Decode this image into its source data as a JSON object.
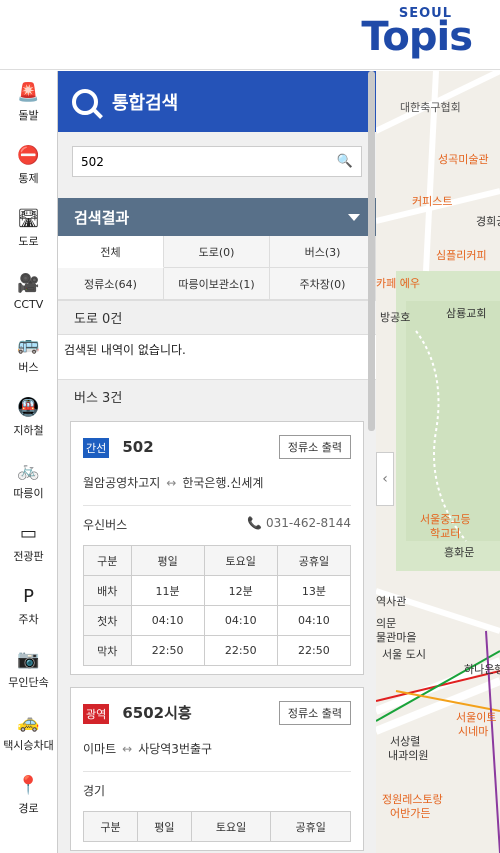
{
  "header": {
    "logo_top": "SEOUL",
    "logo_main": "Topis"
  },
  "sidebar": {
    "items": [
      {
        "label": "돌발",
        "icon": "alert-icon",
        "glyph": "🚨"
      },
      {
        "label": "통제",
        "icon": "no-entry-icon",
        "glyph": "⛔"
      },
      {
        "label": "도로",
        "icon": "road-icon",
        "glyph": "🛣"
      },
      {
        "label": "CCTV",
        "icon": "camera-icon",
        "glyph": "🎥"
      },
      {
        "label": "버스",
        "icon": "bus-icon",
        "glyph": "🚌"
      },
      {
        "label": "지하철",
        "icon": "subway-icon",
        "glyph": "🚇"
      },
      {
        "label": "따릉이",
        "icon": "bicycle-icon",
        "glyph": "🚲"
      },
      {
        "label": "전광판",
        "icon": "billboard-icon",
        "glyph": "▭"
      },
      {
        "label": "주차",
        "icon": "parking-icon",
        "glyph": "P"
      },
      {
        "label": "무인단속",
        "icon": "speed-camera-icon",
        "glyph": "📷"
      },
      {
        "label": "택시승차대",
        "icon": "taxi-icon",
        "glyph": "🚕"
      },
      {
        "label": "경로",
        "icon": "route-icon",
        "glyph": "📍"
      }
    ]
  },
  "panel": {
    "title": "통합검색",
    "search_value": "502",
    "results_label": "검색결과",
    "tabs": [
      "전체",
      "도로(0)",
      "버스(3)",
      "정류소(64)",
      "따릉이보관소(1)",
      "주차장(0)"
    ],
    "road_header": "도로 0건",
    "road_empty": "검색된 내역이 없습니다.",
    "bus_header": "버스 3건",
    "cards": [
      {
        "badge": "간선",
        "badge_color": "#1d5ec0",
        "number": "502",
        "print_label": "정류소 출력",
        "from": "월암공영차고지",
        "arrow": "↔",
        "to": "한국은행.신세계",
        "operator": "우신버스",
        "phone": "031-462-8144",
        "table_head": [
          "구분",
          "평일",
          "토요일",
          "공휴일"
        ],
        "rows": [
          [
            "배차",
            "11분",
            "12분",
            "13분"
          ],
          [
            "첫차",
            "04:10",
            "04:10",
            "04:10"
          ],
          [
            "막차",
            "22:50",
            "22:50",
            "22:50"
          ]
        ]
      },
      {
        "badge": "광역",
        "badge_color": "#d3242a",
        "number": "6502시흥",
        "print_label": "정류소 출력",
        "from": "이마트",
        "arrow": "↔",
        "to": "사당역3번출구",
        "operator": "경기",
        "table_head": [
          "구분",
          "평일",
          "토요일",
          "공휴일"
        ]
      }
    ]
  },
  "map": {
    "labels": [
      {
        "t": "대한축구협회",
        "c": "bl"
      },
      {
        "t": "성곡미술관",
        "c": "or"
      },
      {
        "t": "커피스트",
        "c": "or"
      },
      {
        "t": "경희궁",
        "c": ""
      },
      {
        "t": "심플리커피",
        "c": "or"
      },
      {
        "t": "카페 에우",
        "c": "or"
      },
      {
        "t": "방공호",
        "c": ""
      },
      {
        "t": "삼룡교회",
        "c": ""
      },
      {
        "t": "서울중고등",
        "c": "or"
      },
      {
        "t": "학교터",
        "c": "or"
      },
      {
        "t": "흥화문",
        "c": ""
      },
      {
        "t": "역사관",
        "c": ""
      },
      {
        "t": "의문",
        "c": ""
      },
      {
        "t": "물관마을",
        "c": ""
      },
      {
        "t": "서울 도시",
        "c": ""
      },
      {
        "t": "하나은행",
        "c": ""
      },
      {
        "t": "서울이트",
        "c": "or"
      },
      {
        "t": "시네마",
        "c": "or"
      },
      {
        "t": "서상렬",
        "c": ""
      },
      {
        "t": "내과의원",
        "c": ""
      },
      {
        "t": "정원레스토랑",
        "c": "or"
      },
      {
        "t": "어반가든",
        "c": "or"
      }
    ]
  }
}
